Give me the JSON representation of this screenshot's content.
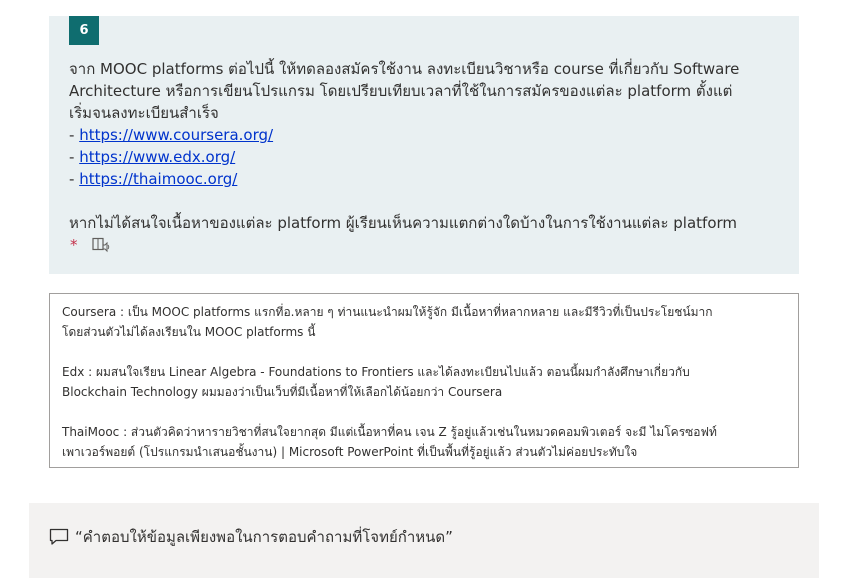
{
  "question": {
    "number": "6",
    "prompt_lines": [
      "จาก MOOC platforms ต่อไปนี้ ให้ทดลองสมัครใช้งาน ลงทะเบียนวิชาหรือ course ที่เกี่ยวกับ Software",
      "Architecture หรือการเขียนโปรแกรม โดยเปรียบเทียบเวลาที่ใช้ในการสมัครของแต่ละ platform ตั้งแต่",
      "เริ่มจนลงทะเบียนสำเร็จ"
    ],
    "links": [
      {
        "prefix": "- ",
        "text": "https://www.coursera.org/"
      },
      {
        "prefix": "- ",
        "text": "https://www.edx.org/"
      },
      {
        "prefix": "- ",
        "text": "https://thaimooc.org/"
      }
    ],
    "followup": "หากไม่ได้สนใจเนื้อหาของแต่ละ platform ผู้เรียนเห็นความแตกต่างใดบ้างในการใช้งานแต่ละ platform",
    "required_mark": "*",
    "icon": "immersive-reader-icon"
  },
  "answer": {
    "paragraphs": [
      [
        "Coursera : เป็น  MOOC platforms แรกที่อ.หลาย ๆ ท่านแนะนำผมให้รู้จัก มีเนื้อหาที่หลากหลาย และมีรีวิวที่เป็นประโยชน์มาก",
        "โดยส่วนตัวไม่ได้ลงเรียนใน  MOOC platforms นี้"
      ],
      [
        "Edx : ผมสนใจเรียน Linear Algebra - Foundations to Frontiers และได้ลงทะเบียนไปแล้ว ตอนนี้ผมกำลังศึกษาเกี่ยวกับ",
        "Blockchain Technology ผมมองว่าเป็นเว็บที่มีเนื้อหาที่ให้เลือกได้น้อยกว่า Coursera"
      ],
      [
        "ThaiMooc : ส่วนตัวคิดว่าหารายวิชาที่สนใจยากสุด มีแต่เนื้อหาที่คน เจน Z รู้อยู่แล้วเช่นในหมวดคอมพิวเตอร์ จะมี ไมโครซอฟท์",
        "เพาเวอร์พอยต์ (โปรแกรมนำเสนอชั้นงาน) | Microsoft PowerPoint ที่เป็นพื้นที่รู้อยู่แล้ว ส่วนตัวไม่ค่อยประทับใจ"
      ]
    ]
  },
  "feedback": {
    "icon": "comment-icon",
    "text": "“คำตอบให้ข้อมูลเพียงพอในการตอบคำถามที่โจทย์กำหนด”"
  }
}
